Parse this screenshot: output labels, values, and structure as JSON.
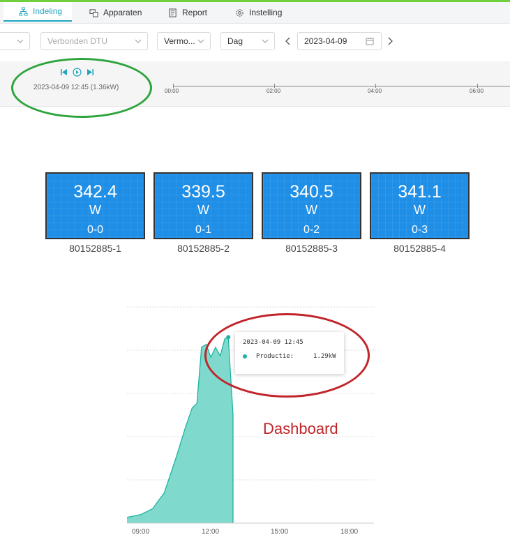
{
  "tabs": [
    {
      "label": "Indeling",
      "active": true
    },
    {
      "label": "Apparaten",
      "active": false
    },
    {
      "label": "Report",
      "active": false
    },
    {
      "label": "Instelling",
      "active": false
    }
  ],
  "filters": {
    "dtu_placeholder": "Verbonden DTU",
    "power_select": "Vermo...",
    "period_select": "Dag",
    "date": "2023-04-09"
  },
  "timeline": {
    "current": "2023-04-09 12:45 (1.36kW)",
    "ticks": [
      "00:00",
      "02:00",
      "04:00",
      "06:00"
    ]
  },
  "panels": [
    {
      "value": "342.4",
      "unit": "W",
      "id": "0-0",
      "serial": "80152885-1"
    },
    {
      "value": "339.5",
      "unit": "W",
      "id": "0-1",
      "serial": "80152885-2"
    },
    {
      "value": "340.5",
      "unit": "W",
      "id": "0-2",
      "serial": "80152885-3"
    },
    {
      "value": "341.1",
      "unit": "W",
      "id": "0-3",
      "serial": "80152885-4"
    }
  ],
  "tooltip": {
    "title": "2023-04-09 12:45",
    "series": "Productie:",
    "value": "1.29kW"
  },
  "annotation": "Dashboard",
  "colors": {
    "accent": "#21a5c0",
    "panel": "#1e8ee6",
    "area": "#7fd9cc",
    "line": "#1fb3a2",
    "green_ring": "#2ea43c",
    "red_ring": "#c0252a"
  },
  "chart_data": {
    "type": "area",
    "xlabel": "",
    "ylabel": "",
    "x_ticks": [
      "09:00",
      "12:00",
      "15:00",
      "18:00"
    ],
    "x_range_hours": [
      8.4,
      19.0
    ],
    "y_range": [
      0,
      1.5
    ],
    "series": [
      {
        "values": [
          [
            8.4,
            0.04
          ],
          [
            9.0,
            0.06
          ],
          [
            9.5,
            0.1
          ],
          [
            10.0,
            0.21
          ],
          [
            10.5,
            0.45
          ],
          [
            10.9,
            0.66
          ],
          [
            11.2,
            0.8
          ],
          [
            11.4,
            0.83
          ],
          [
            11.6,
            1.22
          ],
          [
            11.8,
            1.24
          ],
          [
            12.0,
            1.15
          ],
          [
            12.2,
            1.22
          ],
          [
            12.4,
            1.16
          ],
          [
            12.6,
            1.28
          ],
          [
            12.75,
            1.29
          ],
          [
            12.8,
            1.15
          ],
          [
            12.95,
            0.75
          ],
          [
            12.95,
            0.0
          ]
        ]
      }
    ],
    "highlight": {
      "x": "12:45",
      "value": 1.29
    }
  }
}
